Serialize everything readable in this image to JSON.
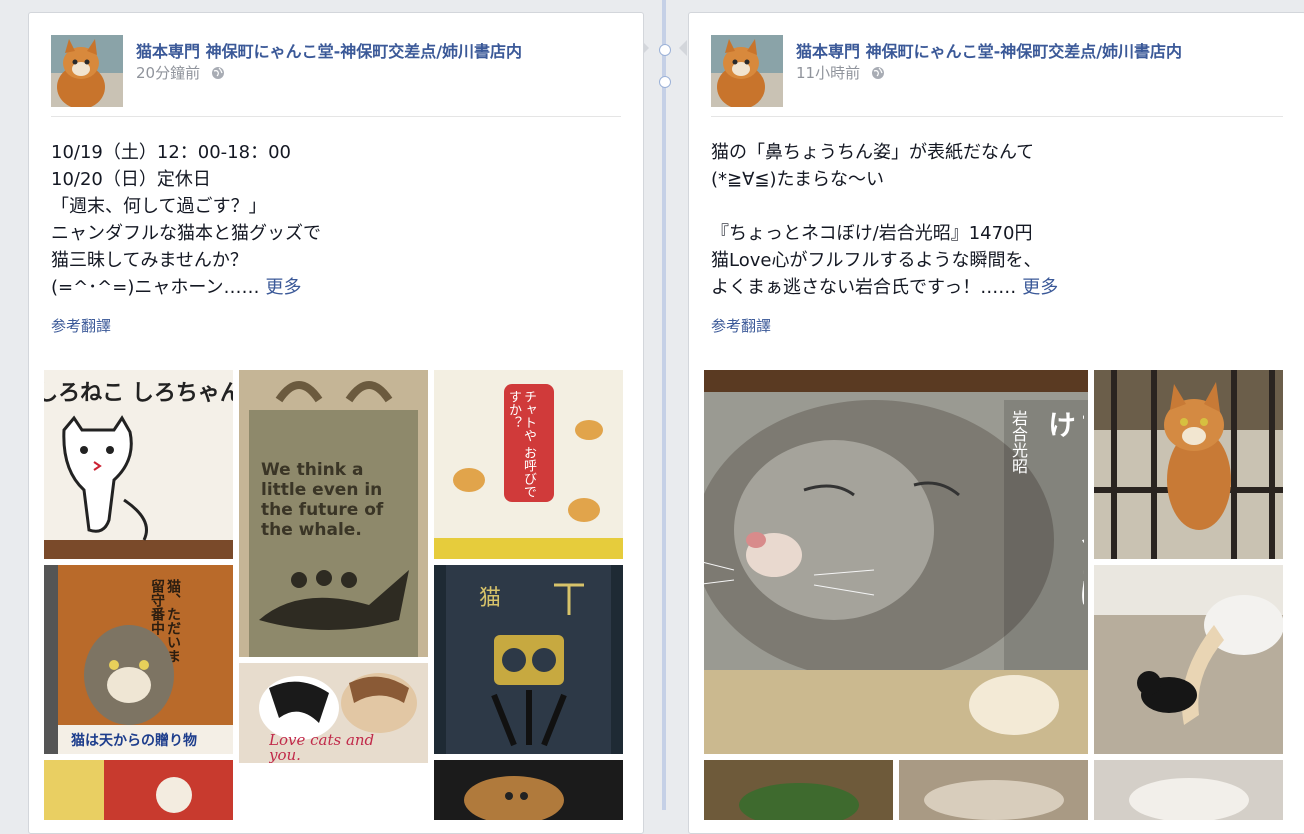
{
  "posts": [
    {
      "author": "猫本専門 神保町にゃんこ堂-神保町交差点/姉川書店内",
      "time": "20分鐘前",
      "lines": [
        "10/19（土）12：00-18：00",
        "10/20（日）定休日",
        "「週末、何して過ごす？」",
        "ニャンダフルな猫本と猫グッズで",
        "猫三昧してみませんか？",
        "(=^･^=)ニャホーン……"
      ],
      "more": "更多",
      "translate": "参考翻譯",
      "photos": {
        "shiro_title": "しろねこ しろちゃん",
        "bag_text": "We think a little even in the future of the whale.",
        "chaya_title": "チャトや お呼びですか？",
        "neko_tadaima": "猫、ただいま 留守番中",
        "neko_ten": "猫は天からの贈り物",
        "neko_kanji": "猫",
        "love_cats": "Love cats and you."
      }
    },
    {
      "author": "猫本専門 神保町にゃんこ堂-神保町交差点/姉川書店内",
      "time": "11小時前",
      "lines": [
        "猫の「鼻ちょうちん姿」が表紙だなんて",
        "(*≧∀≦)たまらな〜い",
        "",
        "『ちょっとネコぼけ/岩合光昭』1470円",
        "猫Love心がフルフルするような瞬間を、",
        "よくまぁ逃さない岩合氏ですっ！……"
      ],
      "more": "更多",
      "translate": "参考翻譯",
      "photos": {
        "book_title": "ちょっとネコぼけ",
        "book_author": "岩合光昭"
      }
    }
  ],
  "colors": {
    "link": "#3b5998",
    "meta": "#90949c",
    "text": "#141823"
  }
}
